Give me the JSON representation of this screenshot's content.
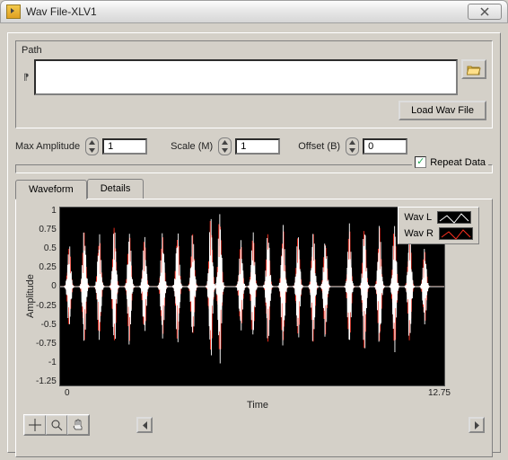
{
  "window": {
    "title": "Wav File-XLV1"
  },
  "path": {
    "label": "Path",
    "value": "",
    "load_button": "Load Wav File"
  },
  "controls": {
    "max_amp_label": "Max Amplitude",
    "max_amp_value": "1",
    "scale_label": "Scale (M)",
    "scale_value": "1",
    "offset_label": "Offset (B)",
    "offset_value": "0",
    "repeat_label": "Repeat Data",
    "repeat_checked": true
  },
  "tabs": {
    "waveform": "Waveform",
    "details": "Details"
  },
  "chart_data": {
    "type": "line",
    "title": "",
    "xlabel": "Time",
    "ylabel": "Amplitude",
    "xlim": [
      0,
      12.75
    ],
    "ylim": [
      -1.25,
      1
    ],
    "y_ticks": [
      "1",
      "0.75",
      "0.5",
      "0.25",
      "0",
      "-0.25",
      "-0.5",
      "-0.75",
      "-1",
      "-1.25"
    ],
    "x_ticks": [
      "0",
      "12.75"
    ],
    "series": [
      {
        "name": "Wav L",
        "color": "#ffffff"
      },
      {
        "name": "Wav R",
        "color": "#ff3020"
      }
    ],
    "comment": "Audio waveform; dense oscillations approximately between -1 and 1 with ~24 burst envelopes across 0–12.75 s. Individual sample values not readable from image."
  },
  "axis": {
    "x_min_label": "0",
    "x_max_label": "12.75"
  },
  "legend": {
    "l": "Wav L",
    "r": "Wav R"
  },
  "icons": {
    "close": "close-icon",
    "folder": "folder-icon",
    "up": "chevron-up-icon",
    "down": "chevron-down-icon",
    "crosshair": "crosshair-icon",
    "zoom": "zoom-icon",
    "hand": "hand-icon",
    "left": "chevron-left-icon",
    "right": "chevron-right-icon"
  }
}
